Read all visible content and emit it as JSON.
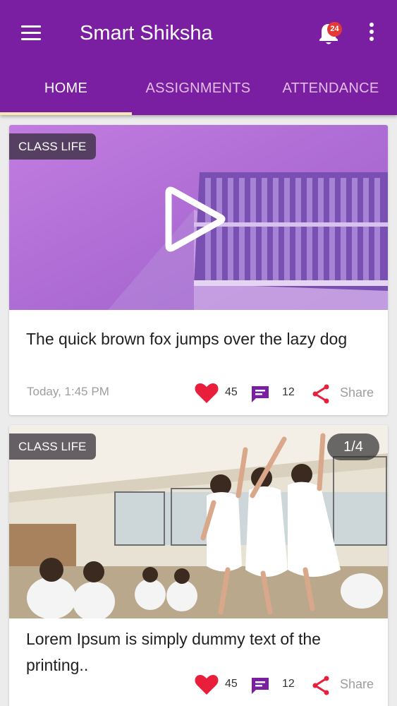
{
  "app": {
    "title": "Smart Shiksha",
    "notification_count": "24"
  },
  "tabs": [
    {
      "label": "HOME",
      "active": true
    },
    {
      "label": "ASSIGNMENTS",
      "active": false
    },
    {
      "label": "ATTENDANCE",
      "active": false
    }
  ],
  "colors": {
    "primary": "#7b1fa2",
    "tab_indicator": "#f7e6b0",
    "accent": "#e91e63",
    "comment": "#7b1fa2"
  },
  "posts": [
    {
      "category": "CLASS LIFE",
      "title": "The quick brown fox jumps over the lazy dog",
      "time": "Today, 1:45 PM",
      "likes": "45",
      "comments": "12",
      "share_label": "Share",
      "media_type": "video"
    },
    {
      "category": "CLASS LIFE",
      "image_counter": "1/4",
      "title": "Lorem Ipsum is simply dummy text of the printing..",
      "likes": "45",
      "comments": "12",
      "share_label": "Share",
      "media_type": "image"
    }
  ]
}
